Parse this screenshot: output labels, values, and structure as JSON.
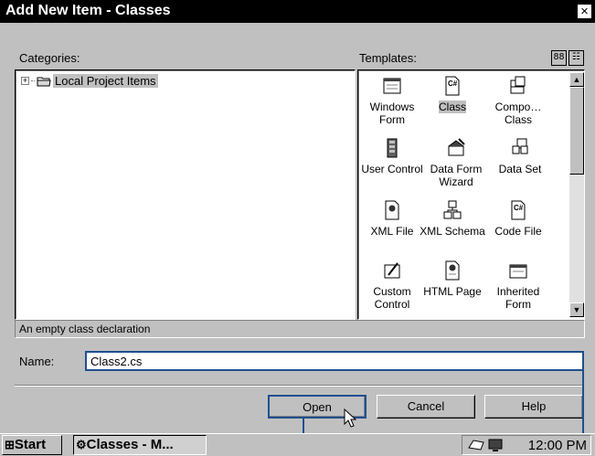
{
  "window": {
    "title": "Add New Item - Classes",
    "close_glyph": "×"
  },
  "categories": {
    "label": "Categories:",
    "items": [
      {
        "label": "Local Project Items",
        "expander": "+"
      }
    ]
  },
  "templates": {
    "label": "Templates:",
    "view_large": "88",
    "view_list": "☷",
    "items": [
      {
        "label": "Windows Form",
        "icon": "windows-form-icon"
      },
      {
        "label": "Class",
        "icon": "class-cs-icon",
        "selected": true
      },
      {
        "label": "Compo… Class",
        "icon": "component-class-icon"
      },
      {
        "label": "User Control",
        "icon": "user-control-icon"
      },
      {
        "label": "Data Form Wizard",
        "icon": "data-form-wizard-icon"
      },
      {
        "label": "Data Set",
        "icon": "data-set-icon"
      },
      {
        "label": "XML File",
        "icon": "xml-file-icon"
      },
      {
        "label": "XML Schema",
        "icon": "xml-schema-icon"
      },
      {
        "label": "Code File",
        "icon": "code-file-icon"
      },
      {
        "label": "Custom Control",
        "icon": "custom-control-icon"
      },
      {
        "label": "HTML Page",
        "icon": "html-page-icon"
      },
      {
        "label": "Inherited Form",
        "icon": "inherited-form-icon"
      }
    ]
  },
  "description": "An empty class declaration",
  "name_field": {
    "label": "Name:",
    "value": "Class2.cs"
  },
  "buttons": {
    "open": "Open",
    "cancel": "Cancel",
    "help": "Help"
  },
  "taskbar": {
    "start": "Start",
    "task": "Classes - M...",
    "clock": "12:00 PM"
  }
}
